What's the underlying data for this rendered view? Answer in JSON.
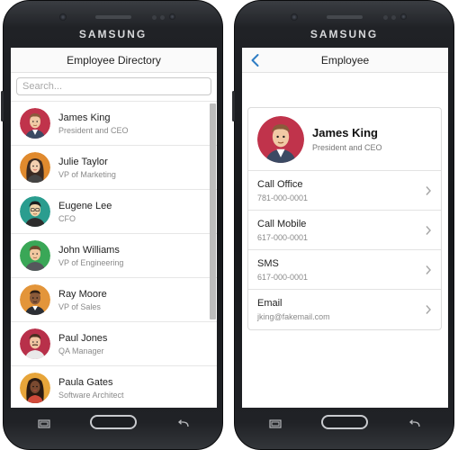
{
  "device": {
    "brand": "SAMSUNG"
  },
  "directory": {
    "title": "Employee Directory",
    "search_placeholder": "Search...",
    "employees": [
      {
        "name": "James King",
        "title": "President and CEO"
      },
      {
        "name": "Julie Taylor",
        "title": "VP of Marketing"
      },
      {
        "name": "Eugene Lee",
        "title": "CFO"
      },
      {
        "name": "John Williams",
        "title": "VP of Engineering"
      },
      {
        "name": "Ray Moore",
        "title": "VP of Sales"
      },
      {
        "name": "Paul Jones",
        "title": "QA Manager"
      },
      {
        "name": "Paula Gates",
        "title": "Software Architect"
      }
    ]
  },
  "detail": {
    "title": "Employee",
    "name": "James King",
    "role": "President and CEO",
    "actions": [
      {
        "label": "Call Office",
        "value": "781-000-0001"
      },
      {
        "label": "Call Mobile",
        "value": "617-000-0001"
      },
      {
        "label": "SMS",
        "value": "617-000-0001"
      },
      {
        "label": "Email",
        "value": "jking@fakemail.com"
      }
    ]
  },
  "colors": {
    "accent": "#2e7dc4",
    "avatar_bg_red": "#c0334b",
    "avatar_bg_orange": "#e08a2e",
    "avatar_bg_teal": "#2a9d8f",
    "avatar_bg_green": "#3aa757"
  }
}
